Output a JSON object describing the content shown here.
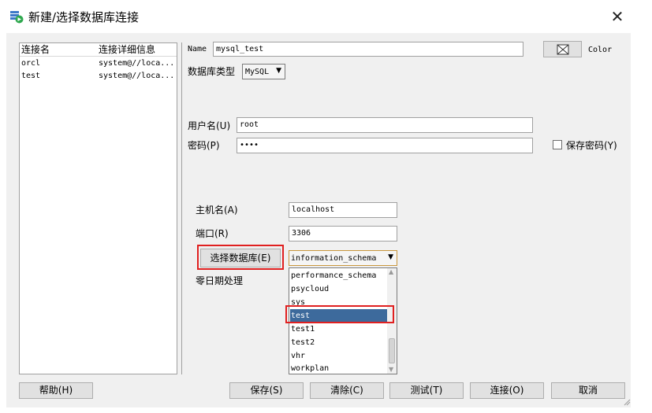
{
  "window": {
    "title": "新建/选择数据库连接",
    "close_glyph": "✕"
  },
  "conn_list": {
    "headers": [
      "连接名",
      "连接详细信息"
    ],
    "rows": [
      {
        "name": "orcl",
        "detail": "system@//loca..."
      },
      {
        "name": "test",
        "detail": "system@//loca..."
      }
    ]
  },
  "form": {
    "name_label": "Name",
    "name_value": "mysql_test",
    "color_label": "Color",
    "db_type_label": "数据库类型",
    "db_type_value": "MySQL",
    "username_label": "用户名(U)",
    "username_value": "root",
    "password_label": "密码(P)",
    "password_value": "••••",
    "save_password_label": "保存密码(Y)",
    "save_password_checked": false,
    "host_label": "主机名(A)",
    "host_value": "localhost",
    "port_label": "端口(R)",
    "port_value": "3306",
    "choose_db_label": "选择数据库(E)",
    "choose_db_value": "information_schema",
    "zero_date_label": "零日期处理"
  },
  "dropdown": {
    "options": [
      "performance_schema",
      "psycloud",
      "sys",
      "test",
      "test1",
      "test2",
      "vhr",
      "workplan"
    ],
    "selected": "test"
  },
  "buttons": {
    "help": "帮助(H)",
    "save": "保存(S)",
    "clear": "清除(C)",
    "test": "测试(T)",
    "connect": "连接(O)",
    "cancel": "取消"
  },
  "icons": {
    "app": "database-connection-icon",
    "color_picker": "color-swatch-icon",
    "combo_arrow": "chevron-down-icon",
    "close": "close-icon"
  },
  "colors": {
    "highlight": "#e02020",
    "selection": "#3d6a9c"
  }
}
